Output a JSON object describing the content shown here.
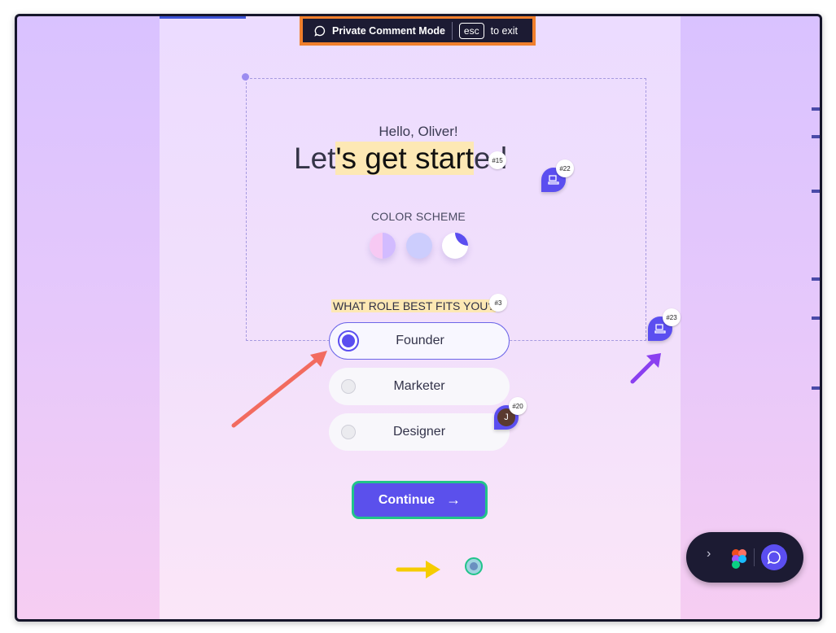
{
  "comment_bar": {
    "title": "Private Comment Mode",
    "esc_key": "esc",
    "exit_text": "to exit"
  },
  "onboarding": {
    "greeting": "Hello, Oliver!",
    "headline_before": "Let",
    "headline_highlight": "'s get start",
    "headline_after": "ed",
    "color_scheme_label": "COLOR SCHEME",
    "role_question": "WHAT ROLE BEST FITS YOU?",
    "roles": [
      {
        "label": "Founder",
        "selected": true
      },
      {
        "label": "Marketer",
        "selected": false
      },
      {
        "label": "Designer",
        "selected": false
      }
    ],
    "continue_label": "Continue",
    "continue_icon": "→"
  },
  "comment_pins": {
    "pin_15": "#15",
    "pin_22": "#22",
    "pin_3": "#3",
    "pin_23": "#23",
    "pin_20": "#20",
    "pin_20_initial": "J"
  },
  "toolbar": {
    "expand_icon": "›"
  },
  "colors": {
    "accent": "#5b4ef0",
    "highlight": "#fde8b4",
    "bar_border": "#f07f2c",
    "continue_border": "#21c48a",
    "arrow_red": "#f26b5f",
    "arrow_purple": "#8a3ff0",
    "arrow_yellow": "#f5cc00"
  }
}
